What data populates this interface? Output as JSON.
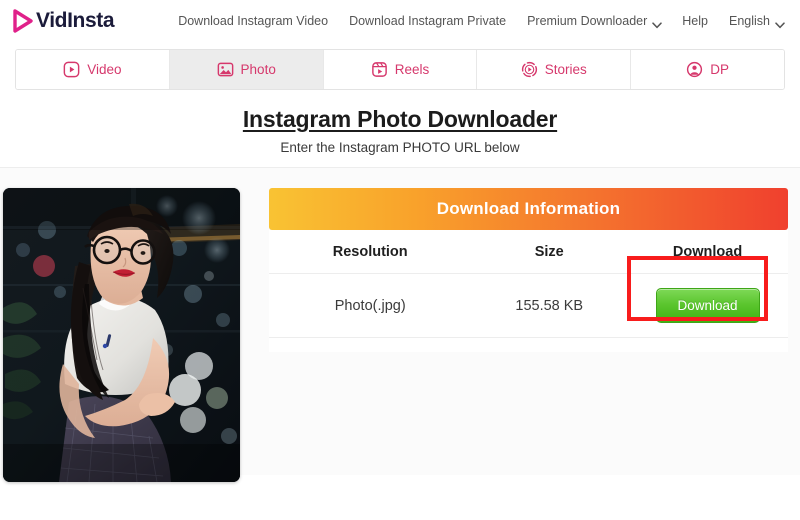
{
  "header": {
    "logo": {
      "text": "VidInsta",
      "icon": "play-triangle-icon",
      "color": "#e0218a"
    },
    "nav": [
      {
        "label": "Download Instagram Video",
        "has_caret": false
      },
      {
        "label": "Download Instagram Private",
        "has_caret": false
      },
      {
        "label": "Premium Downloader",
        "has_caret": true
      },
      {
        "label": "Help",
        "has_caret": false
      },
      {
        "label": "English",
        "has_caret": true
      }
    ]
  },
  "tabs": [
    {
      "label": "Video",
      "icon": "video-play-box-icon",
      "active": false
    },
    {
      "label": "Photo",
      "icon": "image-picture-icon",
      "active": true
    },
    {
      "label": "Reels",
      "icon": "reels-clapper-icon",
      "active": false
    },
    {
      "label": "Stories",
      "icon": "stories-ring-icon",
      "active": false
    },
    {
      "label": "DP",
      "icon": "user-circle-icon",
      "active": false
    }
  ],
  "title": {
    "heading": "Instagram Photo Downloader",
    "subheading": "Enter the Instagram PHOTO URL below"
  },
  "result": {
    "thumbnail_alt": "Portrait photo of a woman with glasses sitting at night with bokeh city lights",
    "banner_label": "Download Information",
    "columns": [
      "Resolution",
      "Size",
      "Download"
    ],
    "rows": [
      {
        "resolution": "Photo(.jpg)",
        "size": "155.58 KB",
        "action_label": "Download"
      }
    ]
  },
  "colors": {
    "brand_pink": "#d6386c",
    "logo_magenta": "#e0218a",
    "banner_gradient_start": "#f9c333",
    "banner_gradient_end": "#f0402e",
    "download_button_green": "#5cc62f",
    "annotation_red": "#f81c1c",
    "active_tab_bg": "#ececec"
  }
}
